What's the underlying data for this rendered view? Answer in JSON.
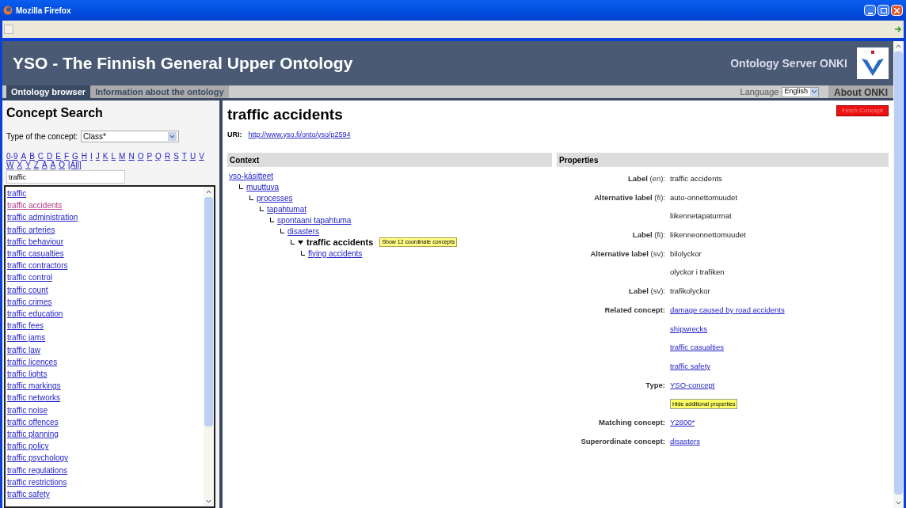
{
  "window": {
    "title": "Mozilla Firefox"
  },
  "header": {
    "title": "YSO - The Finnish General Upper Ontology",
    "server": "Ontology Server ONKI"
  },
  "tabs": [
    {
      "label": "Ontology browser",
      "selected": true
    },
    {
      "label": "Information about the ontology",
      "selected": false
    }
  ],
  "language": {
    "label": "Language",
    "value": "English"
  },
  "about": "About ONKI",
  "search": {
    "title": "Concept Search",
    "type_label": "Type of the concept:",
    "type_value": "Class*",
    "letters": [
      "0-9",
      "A",
      "B",
      "C",
      "D",
      "E",
      "F",
      "G",
      "H",
      "I",
      "J",
      "K",
      "L",
      "M",
      "N",
      "O",
      "P",
      "Q",
      "R",
      "S",
      "T",
      "U",
      "V",
      "W",
      "X",
      "Y",
      "Z",
      "Å",
      "Ä",
      "Ö",
      "[All]"
    ],
    "query": "traffic",
    "results": [
      {
        "label": "traffic",
        "visited": false
      },
      {
        "label": "traffic accidents",
        "visited": true
      },
      {
        "label": "traffic administration",
        "visited": false
      },
      {
        "label": "traffic arteries",
        "visited": false
      },
      {
        "label": "traffic behaviour",
        "visited": false
      },
      {
        "label": "traffic casualties",
        "visited": false
      },
      {
        "label": "traffic contractors",
        "visited": false
      },
      {
        "label": "traffic control",
        "visited": false
      },
      {
        "label": "traffic count",
        "visited": false
      },
      {
        "label": "traffic crimes",
        "visited": false
      },
      {
        "label": "traffic education",
        "visited": false
      },
      {
        "label": "traffic fees",
        "visited": false
      },
      {
        "label": "traffic jams",
        "visited": false
      },
      {
        "label": "traffic law",
        "visited": false
      },
      {
        "label": "traffic licences",
        "visited": false
      },
      {
        "label": "traffic lights",
        "visited": false
      },
      {
        "label": "traffic markings",
        "visited": false
      },
      {
        "label": "traffic networks",
        "visited": false
      },
      {
        "label": "traffic noise",
        "visited": false
      },
      {
        "label": "traffic offences",
        "visited": false
      },
      {
        "label": "traffic planning",
        "visited": false
      },
      {
        "label": "traffic policy",
        "visited": false
      },
      {
        "label": "traffic psychology",
        "visited": false
      },
      {
        "label": "traffic regulations",
        "visited": false
      },
      {
        "label": "traffic restrictions",
        "visited": false
      },
      {
        "label": "traffic safety",
        "visited": false
      }
    ]
  },
  "concept": {
    "title": "traffic accidents",
    "fetch_button": "Fetch Concept",
    "uri_label": "URI:",
    "uri": "http://www.yso.fi/onto/yso/p2594"
  },
  "context": {
    "title": "Context",
    "tree": [
      {
        "label": "yso-käsitteet",
        "kind": "link",
        "children": [
          {
            "label": "muuttuva",
            "kind": "link",
            "children": [
              {
                "label": "processes",
                "kind": "link",
                "children": [
                  {
                    "label": "tapahtumat",
                    "kind": "link",
                    "children": [
                      {
                        "label": "spontaani tapahtuma",
                        "kind": "link",
                        "children": [
                          {
                            "label": "disasters",
                            "kind": "link",
                            "children": [
                              {
                                "label": "traffic accidents",
                                "kind": "current",
                                "expanded": true,
                                "tooltip": "Show 12 coordinate concepts",
                                "children": [
                                  {
                                    "label": "flying accidents",
                                    "kind": "link"
                                  }
                                ]
                              }
                            ]
                          }
                        ]
                      }
                    ]
                  }
                ]
              }
            ]
          }
        ]
      }
    ]
  },
  "properties": {
    "title": "Properties",
    "rows": [
      {
        "label": "**Label** (en):",
        "kind": "text",
        "value": "traffic accidents"
      },
      {
        "label": "**Alternative label** (fi):",
        "kind": "text",
        "value": "auto-onnettomuudet"
      },
      {
        "kind": "text",
        "value": "liikennetapaturmat"
      },
      {
        "label": "**Label** (fi):",
        "kind": "text",
        "value": "liikenneonnettomuudet"
      },
      {
        "label": "**Alternative label** (sv):",
        "kind": "text",
        "value": "bilolyckor"
      },
      {
        "kind": "text",
        "value": "olyckor i trafiken"
      },
      {
        "label": "**Label** (sv):",
        "kind": "text",
        "value": "trafikolyckor"
      },
      {
        "label": "**Related concept:**",
        "kind": "link",
        "value": "damage caused by road accidents"
      },
      {
        "kind": "link",
        "value": "shipwrecks"
      },
      {
        "kind": "link",
        "value": "traffic casualties"
      },
      {
        "kind": "link",
        "value": "traffic safety"
      },
      {
        "label": "**Type:**",
        "kind": "link",
        "value": "YSO-concept"
      },
      {
        "kind": "button",
        "value": "Hide additional properties"
      },
      {
        "label": "**Matching concept:**",
        "kind": "link",
        "value": "Y2800*"
      },
      {
        "label": "**Superordinate concept:**",
        "kind": "link",
        "value": "disasters"
      }
    ]
  }
}
